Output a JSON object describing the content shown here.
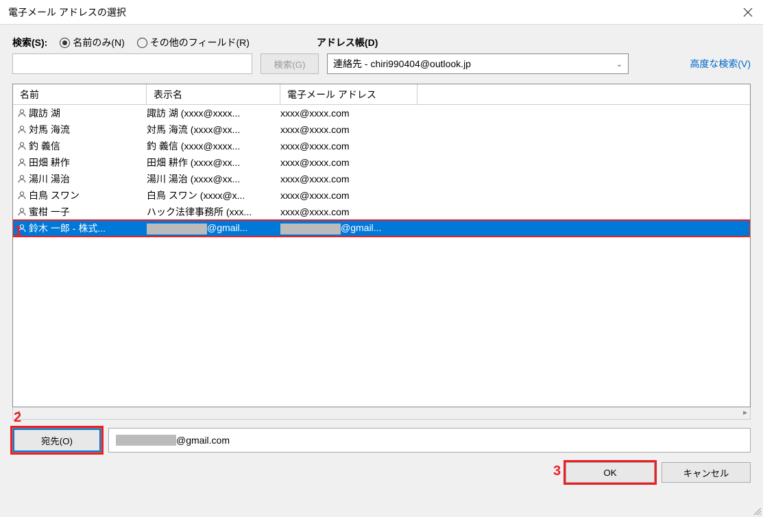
{
  "window": {
    "title": "電子メール アドレスの選択"
  },
  "search": {
    "label": "検索(S):",
    "radio_name_only": "名前のみ(N)",
    "radio_other_fields": "その他のフィールド(R)",
    "button": "検索(G)"
  },
  "addressbook": {
    "label": "アドレス帳(D)",
    "selected": "連絡先 - chiri990404@outlook.jp"
  },
  "advanced_search": "高度な検索(V)",
  "columns": {
    "name": "名前",
    "display": "表示名",
    "email": "電子メール アドレス"
  },
  "contacts": [
    {
      "name": "諏訪 湖",
      "display": "諏訪 湖 (xxxx@xxxx...",
      "email": "xxxx@xxxx.com",
      "selected": false
    },
    {
      "name": "対馬 海流",
      "display": "対馬 海流 (xxxx@xx...",
      "email": "xxxx@xxxx.com",
      "selected": false
    },
    {
      "name": "釣 義信",
      "display": "釣 義信 (xxxx@xxxx...",
      "email": "xxxx@xxxx.com",
      "selected": false
    },
    {
      "name": "田畑 耕作",
      "display": "田畑 耕作 (xxxx@xx...",
      "email": "xxxx@xxxx.com",
      "selected": false
    },
    {
      "name": "湯川 湯治",
      "display": "湯川 湯治 (xxxx@xx...",
      "email": "xxxx@xxxx.com",
      "selected": false
    },
    {
      "name": "白鳥 スワン",
      "display": "白鳥 スワン (xxxx@x...",
      "email": "xxxx@xxxx.com",
      "selected": false
    },
    {
      "name": "蜜柑 一子",
      "display": "ハック法律事務所 (xxx...",
      "email": "xxxx@xxxx.com",
      "selected": false
    },
    {
      "name": "鈴木 一郎 - 株式...",
      "display_suffix": "@gmail...",
      "email_suffix": "@gmail...",
      "selected": true
    }
  ],
  "to": {
    "button": "宛先(O)",
    "value_suffix": "@gmail.com"
  },
  "buttons": {
    "ok": "OK",
    "cancel": "キャンセル"
  },
  "annotations": {
    "a1": "1",
    "a2": "2",
    "a3": "3"
  }
}
